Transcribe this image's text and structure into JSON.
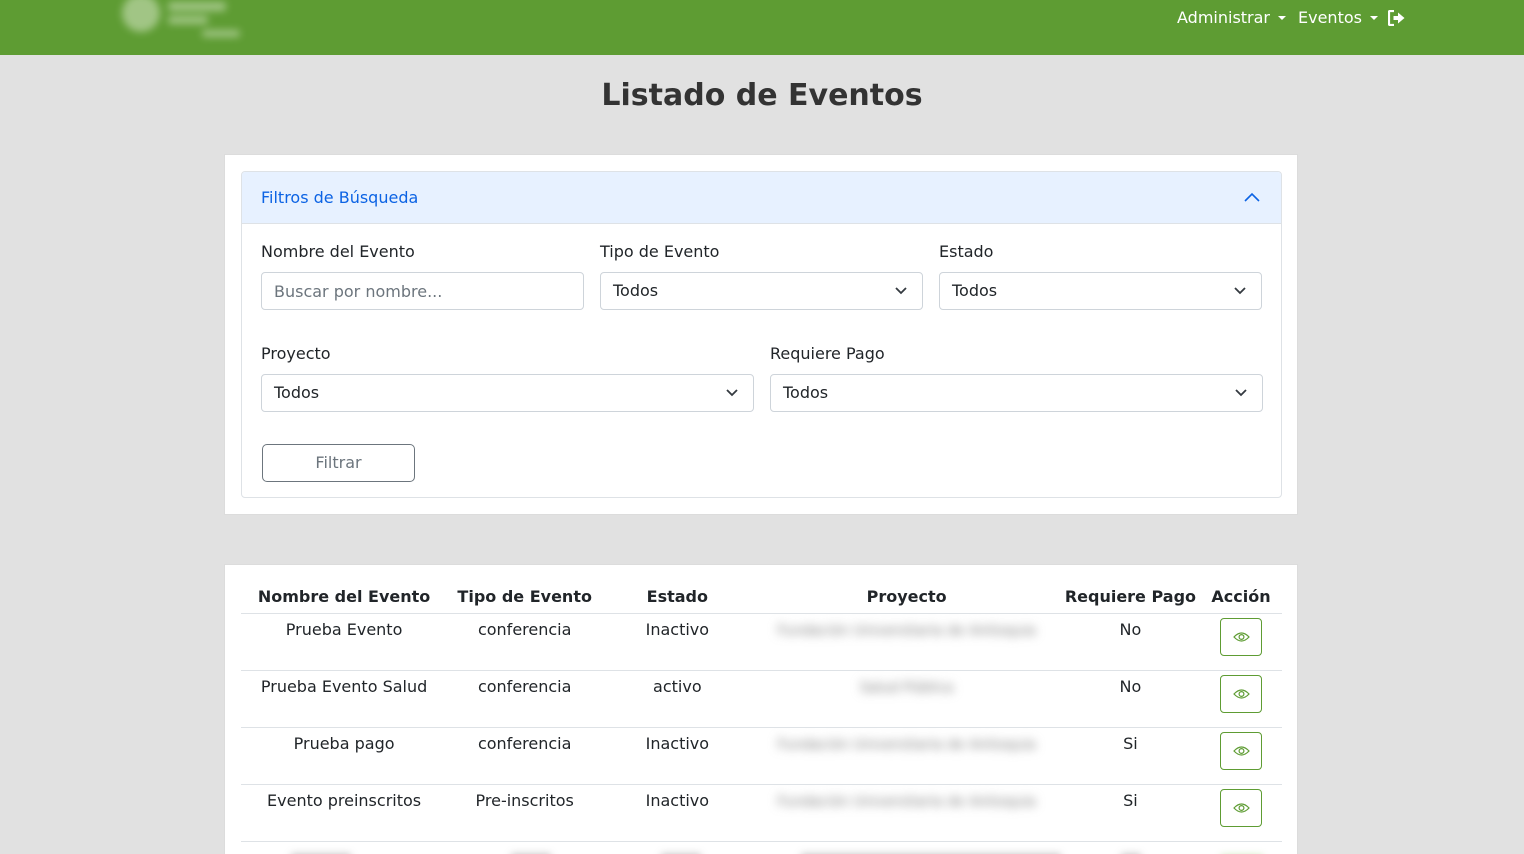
{
  "navbar": {
    "menu": [
      {
        "label": "Administrar"
      },
      {
        "label": "Eventos"
      }
    ],
    "logout_icon": "sign-out-icon",
    "logo_icon": "institution-logo"
  },
  "page": {
    "title": "Listado de Eventos"
  },
  "filters": {
    "header": "Filtros de Búsqueda",
    "nombre_label": "Nombre del Evento",
    "nombre_placeholder": "Buscar por nombre...",
    "nombre_value": "",
    "tipo_label": "Tipo de Evento",
    "tipo_value": "Todos",
    "estado_label": "Estado",
    "estado_value": "Todos",
    "proyecto_label": "Proyecto",
    "proyecto_value": "Todos",
    "pago_label": "Requiere Pago",
    "pago_value": "Todos",
    "filtrar_label": "Filtrar"
  },
  "table": {
    "headers": [
      "Nombre del Evento",
      "Tipo de Evento",
      "Estado",
      "Proyecto",
      "Requiere Pago",
      "Acción"
    ],
    "rows": [
      {
        "nombre": "Prueba Evento",
        "tipo": "conferencia",
        "estado": "Inactivo",
        "proyecto": "Fundación Universitaria de Antioquia",
        "pago": "No"
      },
      {
        "nombre": "Prueba Evento Salud",
        "tipo": "conferencia",
        "estado": "activo",
        "proyecto": "Salud Pública",
        "pago": "No"
      },
      {
        "nombre": "Prueba pago",
        "tipo": "conferencia",
        "estado": "Inactivo",
        "proyecto": "Fundación Universitaria de Antioquia",
        "pago": "Si"
      },
      {
        "nombre": "Evento preinscritos",
        "tipo": "Pre-inscritos",
        "estado": "Inactivo",
        "proyecto": "Fundación Universitaria de Antioquia",
        "pago": "Si"
      }
    ],
    "action_icon": "eye-icon"
  },
  "colors": {
    "navbar": "#5e9c33",
    "background": "#e1e1e1",
    "accordion_header": "#e7f1ff",
    "accordion_text": "#0c63e4"
  }
}
